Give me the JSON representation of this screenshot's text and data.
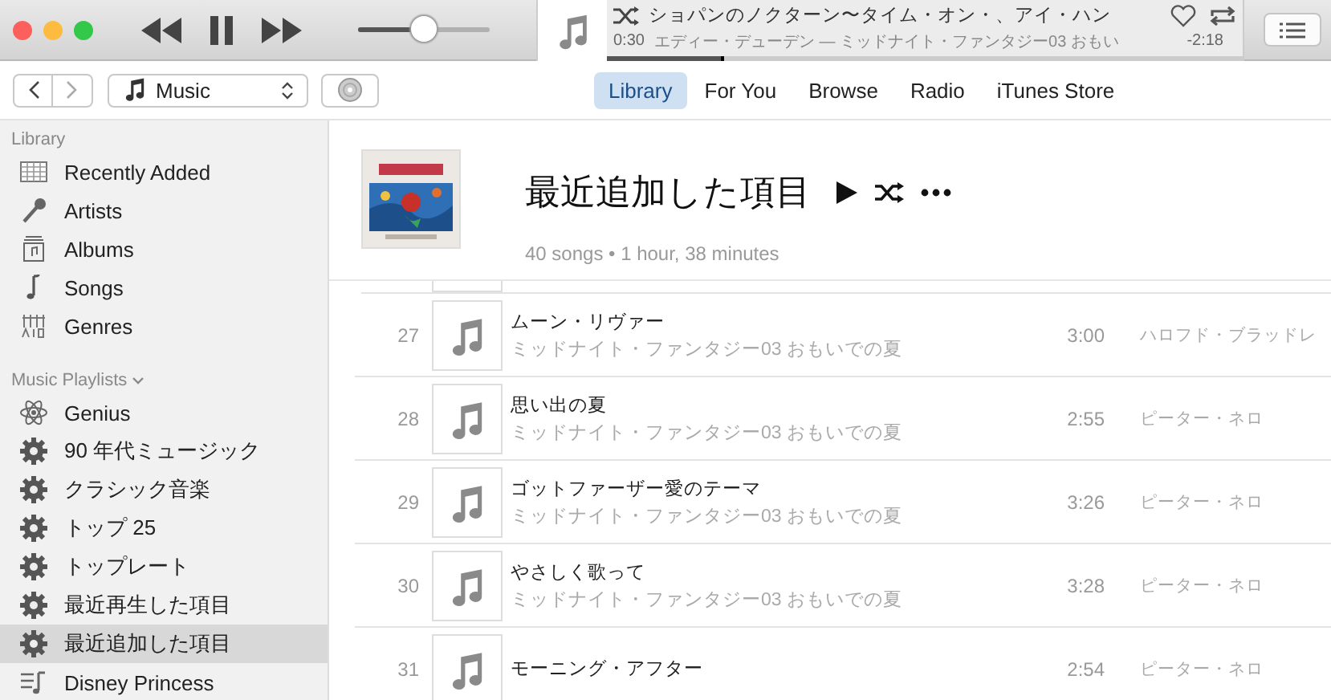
{
  "player": {
    "volume": {
      "level": 0.5
    },
    "now_playing": {
      "title": "ショパンのノクターン〜タイム・オン・、アイ・ハン",
      "subtitle": "エディー・デューデン — ミッドナイト・ファンタジー03 おもい",
      "elapsed": "0:30",
      "remaining": "-2:18",
      "progress": {
        "level": 0.18
      }
    }
  },
  "nav": {
    "source": "Music",
    "tabs": [
      {
        "label": "Library",
        "selected": true
      },
      {
        "label": "For You",
        "selected": false
      },
      {
        "label": "Browse",
        "selected": false
      },
      {
        "label": "Radio",
        "selected": false
      },
      {
        "label": "iTunes Store",
        "selected": false
      }
    ]
  },
  "sidebar": {
    "sections": [
      {
        "title": "Library",
        "collapsible": false,
        "items": [
          {
            "label": "Recently Added",
            "kind": "grid",
            "selected": false
          },
          {
            "label": "Artists",
            "kind": "mic",
            "selected": false
          },
          {
            "label": "Albums",
            "kind": "album",
            "selected": false
          },
          {
            "label": "Songs",
            "kind": "note",
            "selected": false
          },
          {
            "label": "Genres",
            "kind": "genres",
            "selected": false
          }
        ]
      },
      {
        "title": "Music Playlists",
        "collapsible": true,
        "items": [
          {
            "label": "Genius",
            "kind": "atom",
            "selected": false
          },
          {
            "label": "90 年代ミュージック",
            "kind": "smart",
            "selected": false
          },
          {
            "label": "クラシック音楽",
            "kind": "smart",
            "selected": false
          },
          {
            "label": "トップ 25",
            "kind": "smart",
            "selected": false
          },
          {
            "label": "トップレート",
            "kind": "smart",
            "selected": false
          },
          {
            "label": "最近再生した項目",
            "kind": "smart",
            "selected": false
          },
          {
            "label": "最近追加した項目",
            "kind": "smart",
            "selected": true
          },
          {
            "label": "Disney Princess",
            "kind": "playlist",
            "selected": false
          }
        ]
      }
    ]
  },
  "playlist": {
    "title": "最近追加した項目",
    "meta": "40 songs • 1 hour, 38 minutes"
  },
  "tracks": [
    {
      "number": "27",
      "title": "ムーン・リヴァー",
      "album": "ミッドナイト・ファンタジー03 おもいでの夏",
      "time": "3:00",
      "artist": "ハロフド・ブラッドレ"
    },
    {
      "number": "28",
      "title": "思い出の夏",
      "album": "ミッドナイト・ファンタジー03 おもいでの夏",
      "time": "2:55",
      "artist": "ピーター・ネロ"
    },
    {
      "number": "29",
      "title": "ゴットファーザー愛のテーマ",
      "album": "ミッドナイト・ファンタジー03 おもいでの夏",
      "time": "3:26",
      "artist": "ピーター・ネロ"
    },
    {
      "number": "30",
      "title": "やさしく歌って",
      "album": "ミッドナイト・ファンタジー03 おもいでの夏",
      "time": "3:28",
      "artist": "ピーター・ネロ"
    },
    {
      "number": "31",
      "title": "モーニング・アフター",
      "time": "2:54",
      "artist": "ピーター・ネロ"
    }
  ]
}
